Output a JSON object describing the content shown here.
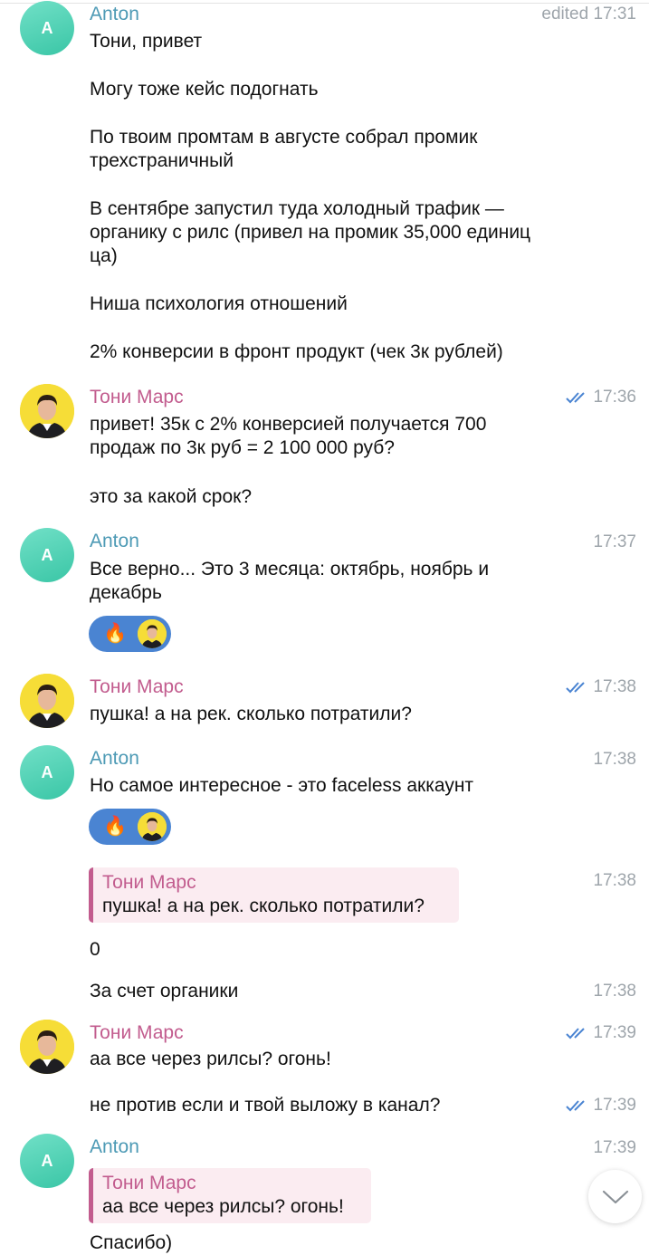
{
  "messages": {
    "m1": {
      "sender": "Anton",
      "avatar_letter": "A",
      "time": "edited 17:31",
      "lines": [
        "Тони, привет",
        "Могу тоже кейс подогнать",
        "По твоим промтам в августе собрал промик трехстраничный",
        "В сентябре запустил туда холодный трафик — органику с рилс (привел на промик 35,000 единиц ца)",
        "Ниша психология отношений",
        "2% конверсии в фронт продукт (чек 3к рублей)"
      ]
    },
    "m2": {
      "sender": "Тони Марс",
      "time": "17:36",
      "lines": [
        "привет! 35к с 2% конверсией получается 700 продаж по 3к руб = 2 100 000 руб?",
        "это за какой срок?"
      ]
    },
    "m3": {
      "sender": "Anton",
      "avatar_letter": "A",
      "time": "17:37",
      "text": "Все верно... Это 3 месяца: октябрь, ноябрь и декабрь",
      "reaction_emoji": "🔥"
    },
    "m4": {
      "sender": "Тони Марс",
      "time": "17:38",
      "text": "пушка! а на рек. сколько потратили?"
    },
    "m5": {
      "sender": "Anton",
      "avatar_letter": "A",
      "time": "17:38",
      "text": "Но самое интересное - это faceless аккаунт",
      "reaction_emoji": "🔥"
    },
    "m6": {
      "time": "17:38",
      "reply_name": "Тони Марс",
      "reply_text": "пушка! а на рек. сколько потратили?",
      "text": "0"
    },
    "m7": {
      "time": "17:38",
      "text": "За счет органики"
    },
    "m8": {
      "sender": "Тони Марс",
      "time": "17:39",
      "text": "аа все через рилсы? огонь!"
    },
    "m9": {
      "time": "17:39",
      "text": "не против если и твой выложу в канал?"
    },
    "m10": {
      "sender": "Anton",
      "avatar_letter": "A",
      "time": "17:39",
      "reply_name": "Тони Марс",
      "reply_text": "аа все через рилсы? огонь!",
      "text": "Спасибо)"
    }
  },
  "colors": {
    "anton_name": "#4d9ab5",
    "toni_name": "#c25c8e",
    "check_marks": "#4a84d2",
    "reaction_pill": "#4a84d2",
    "reply_bg": "#fbecf1",
    "toni_avatar_bg": "#f6dd37"
  },
  "icons": [
    "double-check-icon",
    "fire-emoji",
    "chevron-down-icon"
  ]
}
